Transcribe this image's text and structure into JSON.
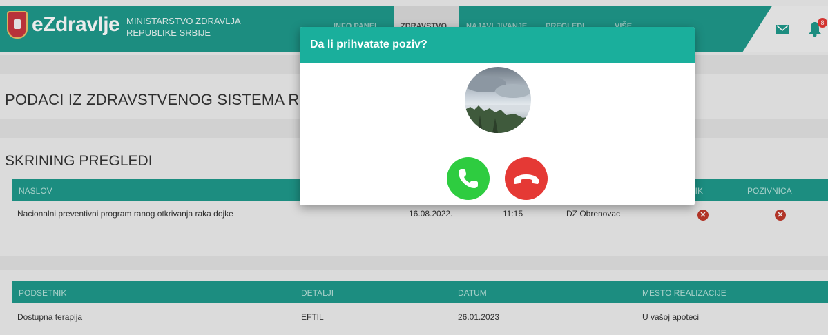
{
  "header": {
    "logo_text": "eZdravlje",
    "ministry_line1": "MINISTARSTVO ZDRAVLJA",
    "ministry_line2": "REPUBLIKE SRBIJE",
    "nav": [
      "INFO PANEL",
      "ZDRAVSTVO",
      "NAJAVLJIVANJE",
      "PREGLEDI",
      "VIŠE"
    ],
    "active_nav_index": 1,
    "notification_count": "8",
    "icons": [
      "serbian-crest-icon",
      "envelope-icon",
      "bell-icon"
    ]
  },
  "page": {
    "title": "PODACI IZ ZDRAVSTVENOG SISTEMA RE"
  },
  "screening": {
    "title": "SKRINING PREGLEDI",
    "columns": [
      "NASLOV",
      "NIK",
      "POZIVNICA"
    ],
    "rows": [
      {
        "naslov": "Nacionalni preventivni program ranog otkrivanja raka dojke",
        "datum": "16.08.2022.",
        "vreme": "11:15",
        "mesto": "DZ Obrenovac"
      }
    ]
  },
  "reminders": {
    "columns": [
      "PODSETNIK",
      "DETALJI",
      "DATUM",
      "MESTO REALIZACIJE"
    ],
    "rows": [
      {
        "podsetnik": "Dostupna terapija",
        "detalji": "EFTIL",
        "datum": "26.01.2023",
        "mesto": "U vašoj apoteci"
      }
    ]
  },
  "modal": {
    "title": "Da li prihvatate poziv?",
    "accept_icon": "phone-accept-icon",
    "reject_icon": "phone-hangup-icon"
  },
  "colors": {
    "brand": "#1f9a8b",
    "modal_header": "#1aaf9c",
    "accept": "#2ecc40",
    "reject": "#e53935"
  }
}
